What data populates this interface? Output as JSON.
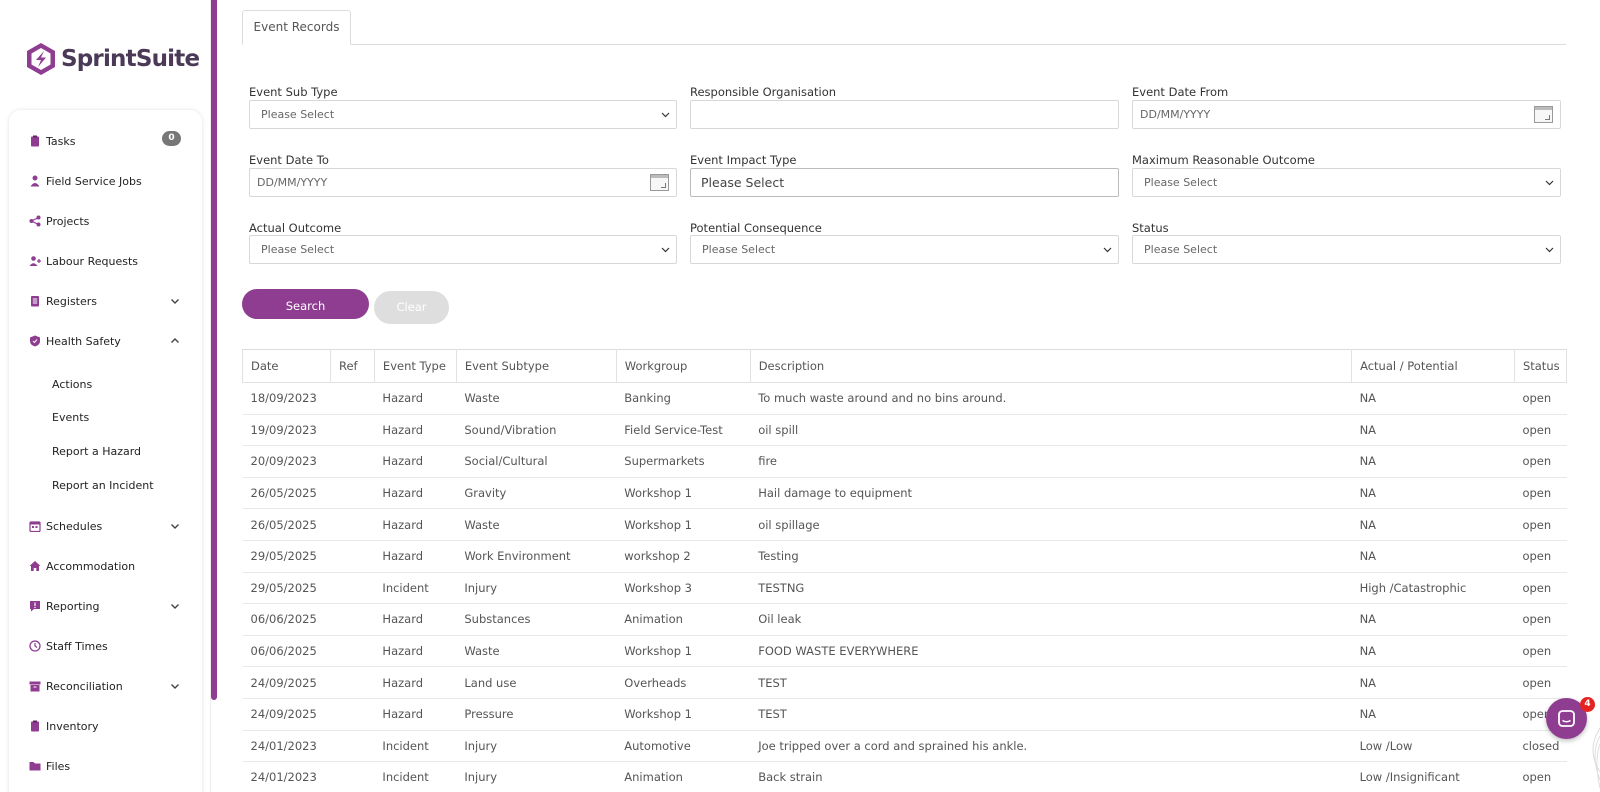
{
  "brand": {
    "name": "SprintSuite",
    "color": "#8e3d91"
  },
  "sidebar": {
    "tasks_badge": "0",
    "items": [
      {
        "label": "Tasks",
        "icon": "clipboard-icon"
      },
      {
        "label": "Field Service Jobs",
        "icon": "worker-icon"
      },
      {
        "label": "Projects",
        "icon": "share-icon"
      },
      {
        "label": "Labour Requests",
        "icon": "user-plus-icon"
      },
      {
        "label": "Registers",
        "icon": "register-icon"
      },
      {
        "label": "Health Safety",
        "icon": "shield-icon"
      },
      {
        "label": "Schedules",
        "icon": "calendar-icon"
      },
      {
        "label": "Accommodation",
        "icon": "home-icon"
      },
      {
        "label": "Reporting",
        "icon": "report-icon"
      },
      {
        "label": "Staff Times",
        "icon": "clock-icon"
      },
      {
        "label": "Reconciliation",
        "icon": "archive-icon"
      },
      {
        "label": "Inventory",
        "icon": "clipboard-icon"
      },
      {
        "label": "Files",
        "icon": "folder-icon"
      }
    ],
    "health_safety_sub": [
      "Actions",
      "Events",
      "Report a Hazard",
      "Report an Incident"
    ]
  },
  "tab": {
    "label": "Event Records"
  },
  "filters": {
    "event_sub_type": {
      "label": "Event Sub Type",
      "value": "Please Select"
    },
    "responsible_org": {
      "label": "Responsible Organisation",
      "value": ""
    },
    "event_date_from": {
      "label": "Event Date From",
      "placeholder": "DD/MM/YYYY"
    },
    "event_date_to": {
      "label": "Event Date To",
      "placeholder": "DD/MM/YYYY"
    },
    "event_impact_type": {
      "label": "Event Impact Type",
      "value": "Please Select"
    },
    "max_reasonable_outcome": {
      "label": "Maximum Reasonable Outcome",
      "value": "Please Select"
    },
    "actual_outcome": {
      "label": "Actual Outcome",
      "value": "Please Select"
    },
    "potential_consequence": {
      "label": "Potential Consequence",
      "value": "Please Select"
    },
    "status": {
      "label": "Status",
      "value": "Please Select"
    }
  },
  "buttons": {
    "search": "Search",
    "clear": "Clear"
  },
  "table": {
    "headers": [
      "Date",
      "Ref",
      "Event Type",
      "Event Subtype",
      "Workgroup",
      "Description",
      "Actual / Potential",
      "Status"
    ],
    "rows": [
      [
        "18/09/2023",
        "",
        "Hazard",
        "Waste",
        "Banking",
        "To much waste around and no bins around.",
        "NA",
        "open"
      ],
      [
        "19/09/2023",
        "",
        "Hazard",
        "Sound/Vibration",
        "Field Service-Test",
        "oil spill",
        "NA",
        "open"
      ],
      [
        "20/09/2023",
        "",
        "Hazard",
        "Social/Cultural",
        "Supermarkets",
        "fire",
        "NA",
        "open"
      ],
      [
        "26/05/2025",
        "",
        "Hazard",
        "Gravity",
        "Workshop 1",
        "Hail damage to equipment",
        "NA",
        "open"
      ],
      [
        "26/05/2025",
        "",
        "Hazard",
        "Waste",
        "Workshop 1",
        "oil spillage",
        "NA",
        "open"
      ],
      [
        "29/05/2025",
        "",
        "Hazard",
        "Work Environment",
        "workshop 2",
        "Testing",
        "NA",
        "open"
      ],
      [
        "29/05/2025",
        "",
        "Incident",
        "Injury",
        "Workshop 3",
        "TESTNG",
        "High /Catastrophic",
        "open"
      ],
      [
        "06/06/2025",
        "",
        "Hazard",
        "Substances",
        "Animation",
        "Oil leak",
        "NA",
        "open"
      ],
      [
        "06/06/2025",
        "",
        "Hazard",
        "Waste",
        "Workshop 1",
        "FOOD WASTE EVERYWHERE",
        "NA",
        "open"
      ],
      [
        "24/09/2025",
        "",
        "Hazard",
        "Land use",
        "Overheads",
        "TEST",
        "NA",
        "open"
      ],
      [
        "24/09/2025",
        "",
        "Hazard",
        "Pressure",
        "Workshop 1",
        "TEST",
        "NA",
        "open"
      ],
      [
        "24/01/2023",
        "",
        "Incident",
        "Injury",
        "Automotive",
        "Joe tripped over a cord and sprained his ankle.",
        "Low /Low",
        "closed"
      ],
      [
        "24/01/2023",
        "",
        "Incident",
        "Injury",
        "Animation",
        "Back strain",
        "Low /Insignificant",
        "open"
      ]
    ]
  },
  "chat": {
    "badge": "4"
  }
}
